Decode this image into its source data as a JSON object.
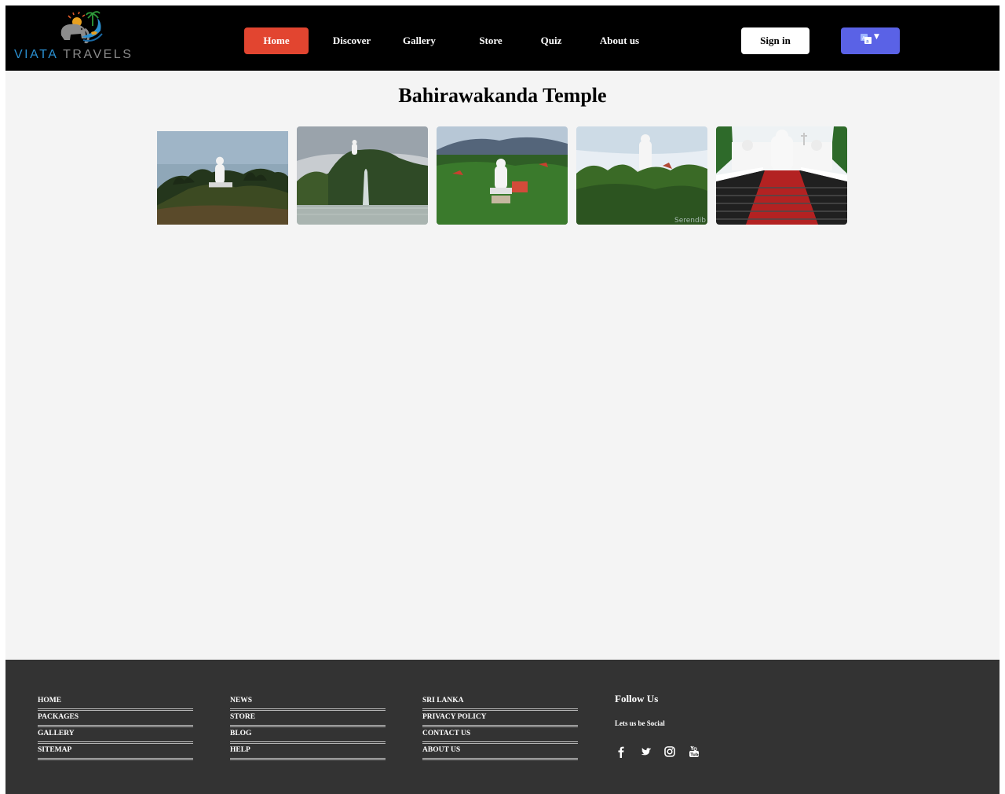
{
  "brand": {
    "name_part1": "VIATA",
    "name_part2": "TRAVELS",
    "colors": {
      "part1": "#2a8fd0",
      "part2": "#8b8b8b"
    }
  },
  "nav": {
    "items": [
      {
        "label": "Home",
        "active": true
      },
      {
        "label": "Discover",
        "active": false
      },
      {
        "label": "Gallery",
        "active": false
      },
      {
        "label": "Store",
        "active": false
      },
      {
        "label": "Quiz",
        "active": false
      },
      {
        "label": "About us",
        "active": false
      }
    ],
    "signin_label": "Sign in",
    "translate_icon": "translate-icon",
    "active_color": "#e24530",
    "translate_color": "#5a62e6"
  },
  "main": {
    "title": "Bahirawakanda Temple",
    "gallery": [
      {
        "icon": "buddha-statue-hill-photo"
      },
      {
        "icon": "lake-fountain-statue-photo"
      },
      {
        "icon": "aerial-temple-photo"
      },
      {
        "icon": "statue-above-trees-photo"
      },
      {
        "icon": "temple-red-stairway-photo"
      }
    ]
  },
  "footer": {
    "columns": [
      [
        "HOME",
        "PACKAGES",
        "GALLERY",
        "SITEMAP"
      ],
      [
        "NEWS",
        "STORE",
        "BLOG",
        "HELP"
      ],
      [
        "SRI LANKA",
        "PRIVACY POLICY",
        "CONTACT US",
        "ABOUT US"
      ]
    ],
    "follow_title": "Follow Us",
    "follow_subtitle": "Lets us be Social",
    "socials": [
      "facebook-icon",
      "twitter-icon",
      "instagram-icon",
      "youtube-icon"
    ]
  }
}
